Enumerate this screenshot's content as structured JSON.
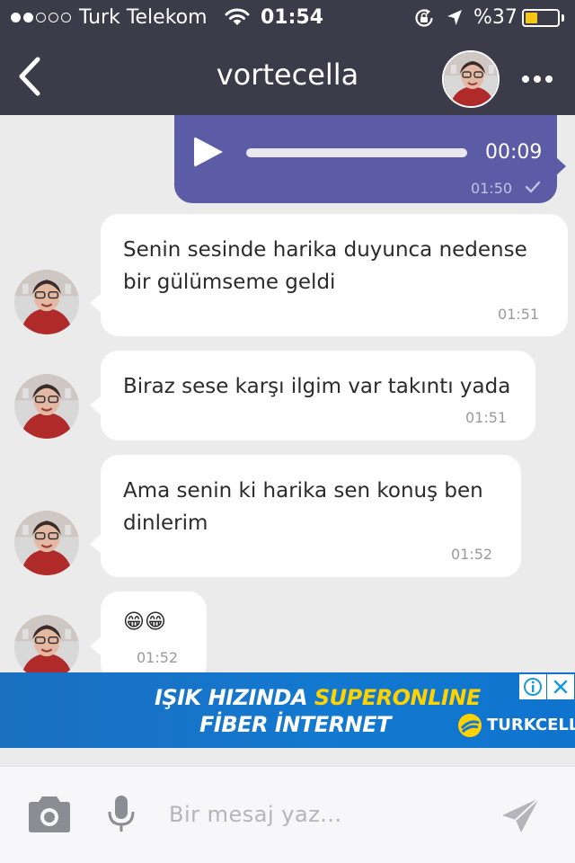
{
  "status_bar": {
    "carrier": "Turk Telekom",
    "time": "01:54",
    "battery_percent": "%37",
    "battery_level": 0.37,
    "signal_dots_filled": 2,
    "signal_dots_total": 5
  },
  "header": {
    "title": "vortecella"
  },
  "messages": {
    "voice": {
      "duration": "00:09",
      "time": "01:50",
      "direction": "outgoing",
      "status": "sent"
    },
    "items": [
      {
        "line1": "Senin sesinde harika duyunca nedense",
        "line2": "bir gülümseme geldi",
        "time": "01:51"
      },
      {
        "line1": "Biraz sese karşı ilgim var takıntı yada",
        "line2": "",
        "time": "01:51"
      },
      {
        "line1": "Ama senin ki harika sen konuş ben",
        "line2": "dinlerim",
        "time": "01:52"
      },
      {
        "line1": "😁😁",
        "line2": "",
        "time": "01:52"
      }
    ]
  },
  "ad": {
    "line1_part1": "IŞIK HIZINDA ",
    "line1_part2": "SUPERONLINE",
    "line2": "FİBER İNTERNET",
    "brand": "TURKCELL"
  },
  "input": {
    "placeholder": "Bir mesaj yaz..."
  },
  "colors": {
    "header_bg": "#3b3b49",
    "chat_bg": "#ebebeb",
    "outgoing_bubble": "#5b5ba6",
    "incoming_bubble": "#ffffff",
    "battery_fill": "#f5c518",
    "ad_blue": "#1378cf",
    "ad_highlight": "#ffd200"
  }
}
